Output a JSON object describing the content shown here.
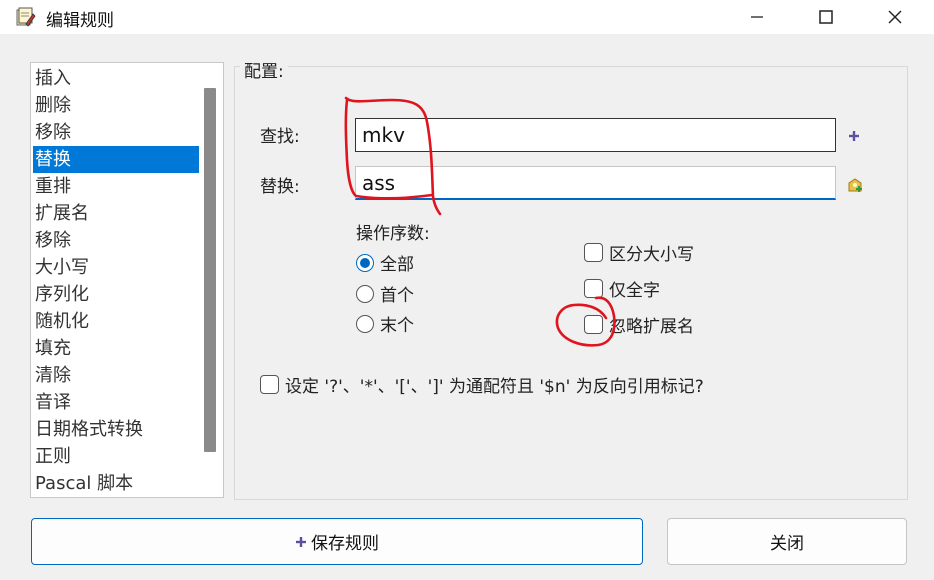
{
  "window": {
    "title": "编辑规则",
    "icon": "app-rule-icon",
    "controls": [
      "minimize-icon",
      "maximize-icon",
      "close-icon"
    ]
  },
  "sidebar": {
    "items": [
      {
        "label": "插入"
      },
      {
        "label": "删除"
      },
      {
        "label": "移除"
      },
      {
        "label": "替换",
        "selected": true
      },
      {
        "label": "重排"
      },
      {
        "label": "扩展名"
      },
      {
        "label": "移除"
      },
      {
        "label": "大小写"
      },
      {
        "label": "序列化"
      },
      {
        "label": "随机化"
      },
      {
        "label": "填充"
      },
      {
        "label": "清除"
      },
      {
        "label": "音译"
      },
      {
        "label": "日期格式转换"
      },
      {
        "label": "正则"
      },
      {
        "label": "Pascal 脚本"
      }
    ]
  },
  "config": {
    "group_label": "配置:",
    "find_label": "查找:",
    "find_value": "mkv",
    "replace_label": "替换:",
    "replace_value": "ass",
    "occurrence_label": "操作序数:",
    "occurrence_options": [
      {
        "label": "全部",
        "checked": true
      },
      {
        "label": "首个",
        "checked": false
      },
      {
        "label": "末个",
        "checked": false
      }
    ],
    "checkboxes": [
      {
        "label": "区分大小写",
        "checked": false
      },
      {
        "label": "仅全字",
        "checked": false
      },
      {
        "label": "忽略扩展名",
        "checked": false
      }
    ],
    "wildcard_label": "设定 '?'、'*'、'['、']' 为通配符且 '$n' 为反向引用标记?",
    "wildcard_checked": false
  },
  "buttons": {
    "save_label": "保存规则",
    "close_label": "关闭"
  },
  "colors": {
    "accent": "#0078d7",
    "annotation": "#e0141e"
  }
}
